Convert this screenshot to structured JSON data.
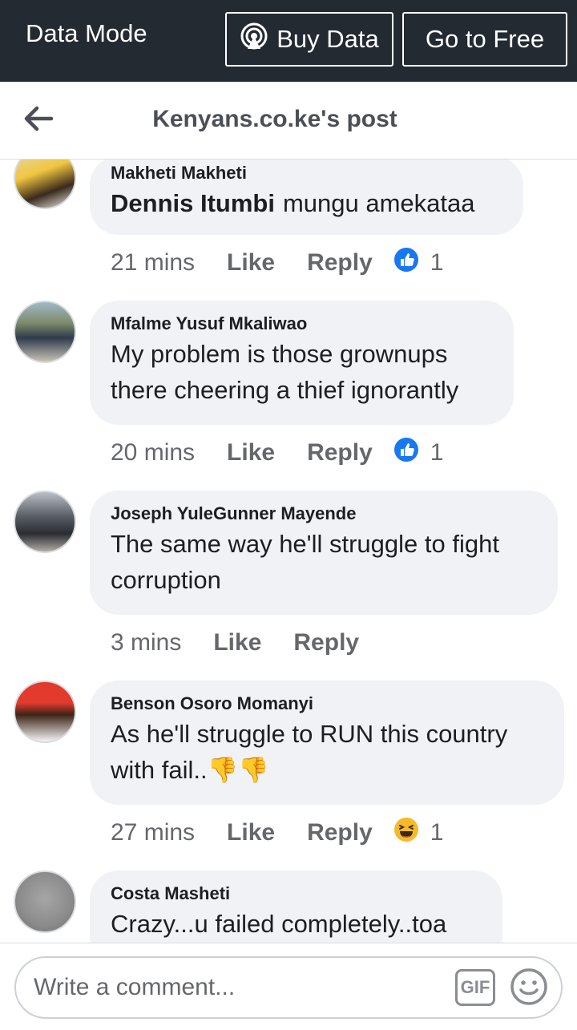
{
  "topbar": {
    "mode_label": "Data Mode",
    "buy_label": "Buy Data",
    "free_label": "Go to Free"
  },
  "header": {
    "title": "Kenyans.co.ke's post"
  },
  "comments": [
    {
      "author": "Makheti Makheti",
      "tag": "Dennis Itumbi",
      "text": "mungu amekataa",
      "time": "21 mins",
      "like": "Like",
      "reply": "Reply",
      "reaction": "like-icon",
      "reaction_count": "1"
    },
    {
      "author": "Mfalme Yusuf Mkaliwao",
      "text_lines": [
        "My problem is those grownups",
        "there cheering a thief ignorantly"
      ],
      "time": "20 mins",
      "like": "Like",
      "reply": "Reply",
      "reaction": "like-icon",
      "reaction_count": "1"
    },
    {
      "author": "Joseph YuleGunner Mayende",
      "text_lines": [
        "The same way he'll struggle to fight",
        "corruption"
      ],
      "time": "3 mins",
      "like": "Like",
      "reply": "Reply"
    },
    {
      "author": "Benson Osoro Momanyi",
      "text_lines": [
        "As he'll struggle to RUN this country",
        "with fail..👎👎"
      ],
      "time": "27 mins",
      "like": "Like",
      "reply": "Reply",
      "reaction": "haha-icon",
      "reaction_count": "1"
    },
    {
      "author": "Costa Masheti",
      "text_lines": [
        "Crazy...u failed completely..toa"
      ]
    }
  ],
  "composer": {
    "placeholder": "Write a comment...",
    "gif_label": "GIF"
  },
  "colors": {
    "topbar_bg": "#232a32",
    "bubble_bg": "#f0f2f5",
    "like_blue": "#1877f2",
    "haha_yellow": "#f7b928"
  }
}
